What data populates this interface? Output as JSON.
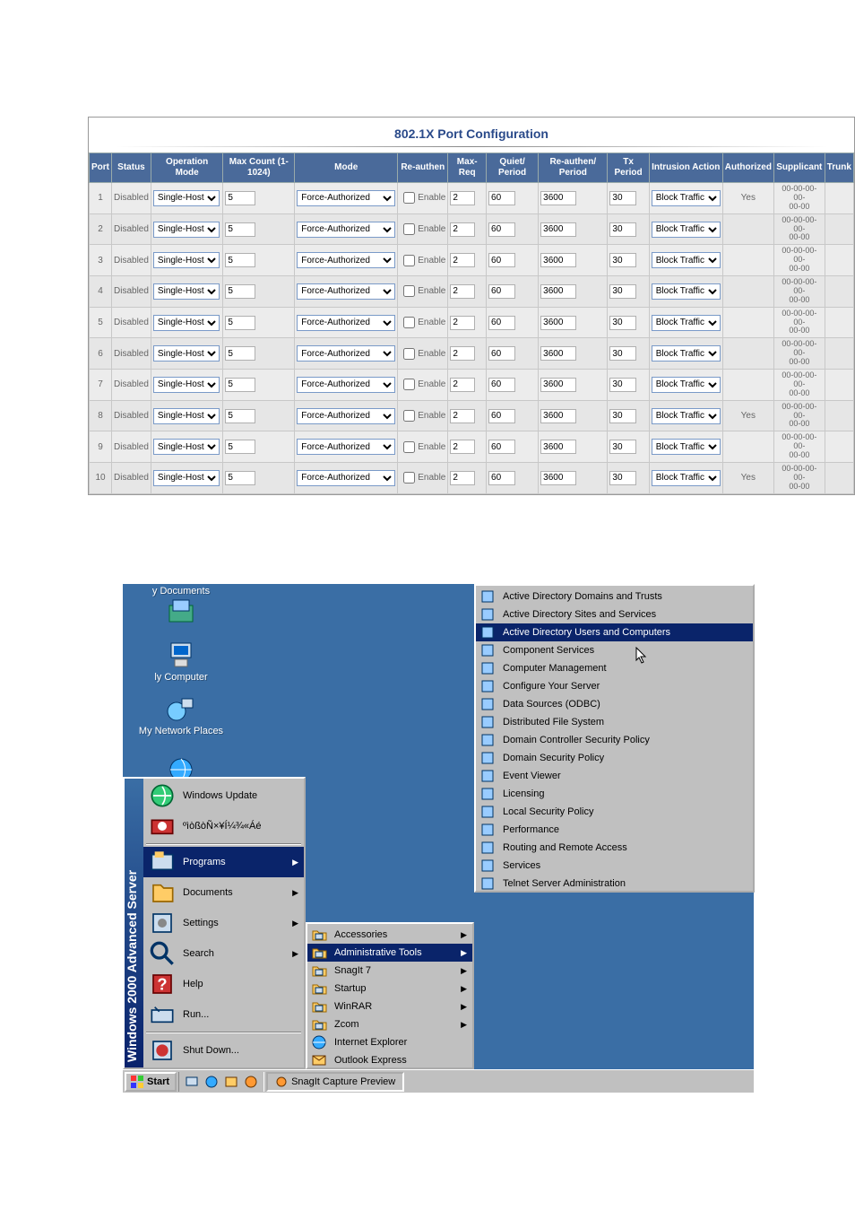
{
  "port_config": {
    "title": "802.1X Port Configuration",
    "headers": {
      "port": "Port",
      "status": "Status",
      "op_mode": "Operation Mode",
      "max_count": "Max Count (1-1024)",
      "mode": "Mode",
      "reauthen": "Re-authen",
      "max_req": "Max-Req",
      "quiet_period": "Quiet/ Period",
      "reauth_period": "Re-authen/ Period",
      "tx_period": "Tx Period",
      "intrusion": "Intrusion Action",
      "authorized": "Authorized",
      "supplicant": "Supplicant",
      "trunk": "Trunk"
    },
    "reauth_label": "Enable",
    "rows": [
      {
        "port": "1",
        "status": "Disabled",
        "op_mode": "Single-Host",
        "max_count": "5",
        "mode": "Force-Authorized",
        "reauth": false,
        "max_req": "2",
        "quiet": "60",
        "reauth_period": "3600",
        "tx": "30",
        "intrusion": "Block Traffic",
        "authorized": "Yes",
        "supplicant": "00-00-00-00-00-00",
        "trunk": ""
      },
      {
        "port": "2",
        "status": "Disabled",
        "op_mode": "Single-Host",
        "max_count": "5",
        "mode": "Force-Authorized",
        "reauth": false,
        "max_req": "2",
        "quiet": "60",
        "reauth_period": "3600",
        "tx": "30",
        "intrusion": "Block Traffic",
        "authorized": "",
        "supplicant": "00-00-00-00-00-00",
        "trunk": ""
      },
      {
        "port": "3",
        "status": "Disabled",
        "op_mode": "Single-Host",
        "max_count": "5",
        "mode": "Force-Authorized",
        "reauth": false,
        "max_req": "2",
        "quiet": "60",
        "reauth_period": "3600",
        "tx": "30",
        "intrusion": "Block Traffic",
        "authorized": "",
        "supplicant": "00-00-00-00-00-00",
        "trunk": ""
      },
      {
        "port": "4",
        "status": "Disabled",
        "op_mode": "Single-Host",
        "max_count": "5",
        "mode": "Force-Authorized",
        "reauth": false,
        "max_req": "2",
        "quiet": "60",
        "reauth_period": "3600",
        "tx": "30",
        "intrusion": "Block Traffic",
        "authorized": "",
        "supplicant": "00-00-00-00-00-00",
        "trunk": ""
      },
      {
        "port": "5",
        "status": "Disabled",
        "op_mode": "Single-Host",
        "max_count": "5",
        "mode": "Force-Authorized",
        "reauth": false,
        "max_req": "2",
        "quiet": "60",
        "reauth_period": "3600",
        "tx": "30",
        "intrusion": "Block Traffic",
        "authorized": "",
        "supplicant": "00-00-00-00-00-00",
        "trunk": ""
      },
      {
        "port": "6",
        "status": "Disabled",
        "op_mode": "Single-Host",
        "max_count": "5",
        "mode": "Force-Authorized",
        "reauth": false,
        "max_req": "2",
        "quiet": "60",
        "reauth_period": "3600",
        "tx": "30",
        "intrusion": "Block Traffic",
        "authorized": "",
        "supplicant": "00-00-00-00-00-00",
        "trunk": ""
      },
      {
        "port": "7",
        "status": "Disabled",
        "op_mode": "Single-Host",
        "max_count": "5",
        "mode": "Force-Authorized",
        "reauth": false,
        "max_req": "2",
        "quiet": "60",
        "reauth_period": "3600",
        "tx": "30",
        "intrusion": "Block Traffic",
        "authorized": "",
        "supplicant": "00-00-00-00-00-00",
        "trunk": ""
      },
      {
        "port": "8",
        "status": "Disabled",
        "op_mode": "Single-Host",
        "max_count": "5",
        "mode": "Force-Authorized",
        "reauth": false,
        "max_req": "2",
        "quiet": "60",
        "reauth_period": "3600",
        "tx": "30",
        "intrusion": "Block Traffic",
        "authorized": "Yes",
        "supplicant": "00-00-00-00-00-00",
        "trunk": ""
      },
      {
        "port": "9",
        "status": "Disabled",
        "op_mode": "Single-Host",
        "max_count": "5",
        "mode": "Force-Authorized",
        "reauth": false,
        "max_req": "2",
        "quiet": "60",
        "reauth_period": "3600",
        "tx": "30",
        "intrusion": "Block Traffic",
        "authorized": "",
        "supplicant": "00-00-00-00-00-00",
        "trunk": ""
      },
      {
        "port": "10",
        "status": "Disabled",
        "op_mode": "Single-Host",
        "max_count": "5",
        "mode": "Force-Authorized",
        "reauth": false,
        "max_req": "2",
        "quiet": "60",
        "reauth_period": "3600",
        "tx": "30",
        "intrusion": "Block Traffic",
        "authorized": "Yes",
        "supplicant": "00-00-00-00-00-00",
        "trunk": ""
      }
    ]
  },
  "start_menu": {
    "desktop": {
      "documents": "y Documents",
      "computer": "ly Computer",
      "network": "My Network Places"
    },
    "side_text": "Windows 2000 Advanced Server",
    "top_items": [
      {
        "label": "Windows Update",
        "icon": "globe-update-icon"
      },
      {
        "label": "ºìòßòÑ×¥Í¼¾«Áé",
        "icon": "camera-icon"
      }
    ],
    "main_items": [
      {
        "label": "Programs",
        "icon": "programs-icon",
        "sub": true,
        "selected": true
      },
      {
        "label": "Documents",
        "icon": "documents-icon",
        "sub": true
      },
      {
        "label": "Settings",
        "icon": "settings-icon",
        "sub": true
      },
      {
        "label": "Search",
        "icon": "search-icon",
        "sub": true
      },
      {
        "label": "Help",
        "icon": "help-icon"
      },
      {
        "label": "Run...",
        "icon": "run-icon"
      }
    ],
    "shutdown": {
      "label": "Shut Down...",
      "icon": "shutdown-icon"
    },
    "programs_submenu": [
      {
        "label": "Accessories",
        "icon": "folder-prog-icon",
        "sub": true
      },
      {
        "label": "Administrative Tools",
        "icon": "folder-prog-icon",
        "sub": true,
        "selected": true
      },
      {
        "label": "SnagIt 7",
        "icon": "folder-prog-icon",
        "sub": true
      },
      {
        "label": "Startup",
        "icon": "folder-prog-icon",
        "sub": true
      },
      {
        "label": "WinRAR",
        "icon": "folder-prog-icon",
        "sub": true
      },
      {
        "label": "Zcom",
        "icon": "folder-prog-icon",
        "sub": true
      },
      {
        "label": "Internet Explorer",
        "icon": "ie-icon"
      },
      {
        "label": "Outlook Express",
        "icon": "outlook-icon"
      }
    ],
    "admin_submenu": [
      {
        "label": "Active Directory Domains and Trusts",
        "icon": "ad-domains-icon"
      },
      {
        "label": "Active Directory Sites and Services",
        "icon": "ad-sites-icon"
      },
      {
        "label": "Active Directory Users and Computers",
        "icon": "ad-users-icon",
        "selected": true
      },
      {
        "label": "Component Services",
        "icon": "component-services-icon"
      },
      {
        "label": "Computer Management",
        "icon": "computer-mgmt-icon"
      },
      {
        "label": "Configure Your Server",
        "icon": "configure-server-icon"
      },
      {
        "label": "Data Sources (ODBC)",
        "icon": "odbc-icon"
      },
      {
        "label": "Distributed File System",
        "icon": "dfs-icon"
      },
      {
        "label": "Domain Controller Security Policy",
        "icon": "dc-security-icon"
      },
      {
        "label": "Domain Security Policy",
        "icon": "domain-security-icon"
      },
      {
        "label": "Event Viewer",
        "icon": "event-viewer-icon"
      },
      {
        "label": "Licensing",
        "icon": "licensing-icon"
      },
      {
        "label": "Local Security Policy",
        "icon": "local-security-icon"
      },
      {
        "label": "Performance",
        "icon": "performance-icon"
      },
      {
        "label": "Routing and Remote Access",
        "icon": "routing-icon"
      },
      {
        "label": "Services",
        "icon": "services-icon"
      },
      {
        "label": "Telnet Server Administration",
        "icon": "telnet-icon"
      }
    ],
    "taskbar": {
      "start": "Start",
      "active_task": "SnagIt Capture Preview"
    }
  }
}
